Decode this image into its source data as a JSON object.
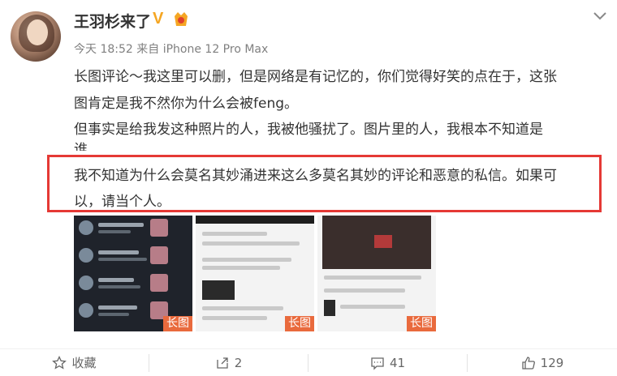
{
  "post": {
    "username": "王羽杉来了",
    "verified_mark": "V",
    "time": "今天 18:52",
    "source_prefix": "来自",
    "device": "iPhone 12 Pro Max",
    "lines": [
      "长图评论～我这里可以删，但是网络是有记忆的，你们觉得好笑的点在于，这张",
      "图肯定是我不然你为什么会被feng。",
      "但事实是给我发这种照片的人，我被他骚扰了。图片里的人，我根本不知道是",
      "谁",
      "我不知道为什么会莫名其妙涌进来这么多莫名其妙的评论和恶意的私信。如果可",
      "以，请当个人。"
    ],
    "highlight_color": "#e53935",
    "image_badges": [
      "长图",
      "长图",
      "长图"
    ]
  },
  "toolbar": {
    "favorite_label": "收藏",
    "repost_count": "2",
    "comment_count": "41",
    "like_count": "129"
  },
  "icons": [
    "avatar",
    "verified-icon",
    "vip-icon",
    "chevron-down-icon",
    "star-icon",
    "repost-icon",
    "comment-icon",
    "like-icon"
  ]
}
